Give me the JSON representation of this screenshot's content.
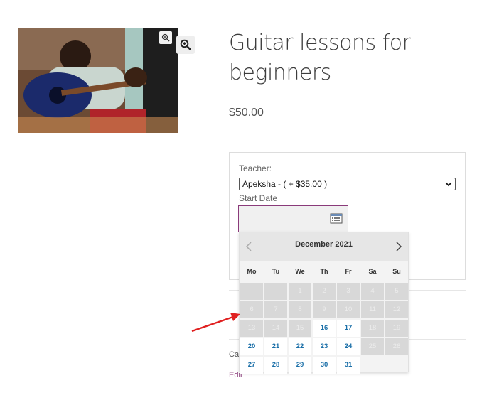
{
  "product": {
    "title": "Guitar lessons for beginners",
    "price": "$50.00",
    "image_alt": "Person playing guitar"
  },
  "booking": {
    "teacher_label": "Teacher:",
    "teacher_selected": "Apeksha - ( + $35.00 )",
    "start_date_label": "Start Date",
    "start_date_value": ""
  },
  "datepicker": {
    "month_label": "December 2021",
    "weekdays": [
      "Mo",
      "Tu",
      "We",
      "Th",
      "Fr",
      "Sa",
      "Su"
    ],
    "weeks": [
      [
        {
          "d": "",
          "s": "empty"
        },
        {
          "d": "",
          "s": "empty"
        },
        {
          "d": "1",
          "s": "disabled"
        },
        {
          "d": "2",
          "s": "disabled"
        },
        {
          "d": "3",
          "s": "disabled"
        },
        {
          "d": "4",
          "s": "disabled"
        },
        {
          "d": "5",
          "s": "disabled"
        }
      ],
      [
        {
          "d": "6",
          "s": "disabled"
        },
        {
          "d": "7",
          "s": "disabled"
        },
        {
          "d": "8",
          "s": "disabled"
        },
        {
          "d": "9",
          "s": "disabled"
        },
        {
          "d": "10",
          "s": "disabled"
        },
        {
          "d": "11",
          "s": "disabled"
        },
        {
          "d": "12",
          "s": "disabled"
        }
      ],
      [
        {
          "d": "13",
          "s": "disabled"
        },
        {
          "d": "14",
          "s": "disabled"
        },
        {
          "d": "15",
          "s": "disabled"
        },
        {
          "d": "16",
          "s": "available"
        },
        {
          "d": "17",
          "s": "available"
        },
        {
          "d": "18",
          "s": "disabled"
        },
        {
          "d": "19",
          "s": "disabled"
        }
      ],
      [
        {
          "d": "20",
          "s": "available"
        },
        {
          "d": "21",
          "s": "available"
        },
        {
          "d": "22",
          "s": "available"
        },
        {
          "d": "23",
          "s": "available"
        },
        {
          "d": "24",
          "s": "available"
        },
        {
          "d": "25",
          "s": "disabled"
        },
        {
          "d": "26",
          "s": "disabled"
        }
      ],
      [
        {
          "d": "27",
          "s": "available"
        },
        {
          "d": "28",
          "s": "available"
        },
        {
          "d": "29",
          "s": "available"
        },
        {
          "d": "30",
          "s": "available"
        },
        {
          "d": "31",
          "s": "available"
        },
        {
          "d": "",
          "s": "blank"
        },
        {
          "d": "",
          "s": "blank"
        }
      ]
    ]
  },
  "meta": {
    "categories_partial": "Cat",
    "edit_link": "Edit"
  },
  "colors": {
    "accent": "#8a3a7a",
    "available_day": "#1a6fa8",
    "arrow": "#e02020"
  },
  "icons": {
    "zoom": "magnifier-plus-icon",
    "calendar": "calendar-icon",
    "prev": "chevron-left-icon",
    "next": "chevron-right-icon"
  }
}
